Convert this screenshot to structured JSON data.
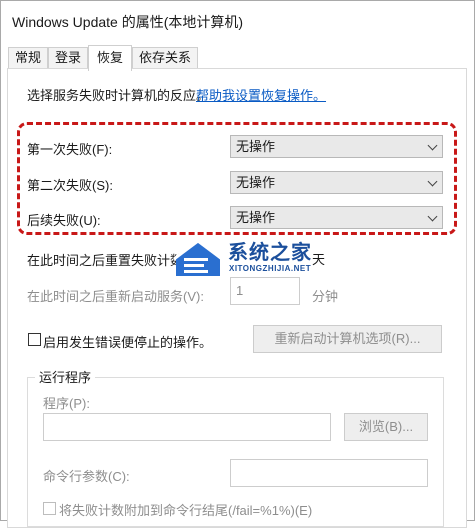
{
  "window": {
    "title": "Windows Update 的属性(本地计算机)"
  },
  "tabs": [
    {
      "label": "常规",
      "active": false
    },
    {
      "label": "登录",
      "active": false
    },
    {
      "label": "恢复",
      "active": true
    },
    {
      "label": "依存关系",
      "active": false
    }
  ],
  "recovery": {
    "intro": "选择服务失败时计算机的反应。",
    "help_link": "帮助我设置恢复操作。",
    "first_failure": {
      "label": "第一次失败(F):",
      "value": "无操作"
    },
    "second_failure": {
      "label": "第二次失败(S):",
      "value": "无操作"
    },
    "subsequent_failures": {
      "label": "后续失败(U):",
      "value": "无操作"
    },
    "reset_count": {
      "label": "在此时间之后重置失败计数",
      "unit": "天"
    },
    "restart_service": {
      "label": "在此时间之后重新启动服务(V):",
      "value": "1",
      "unit": "分钟"
    },
    "enable_actions": {
      "label": "启用发生错误便停止的操作。",
      "checked": false
    },
    "restart_computer_button": "重新启动计算机选项(R)..."
  },
  "run_program": {
    "title": "运行程序",
    "program_label": "程序(P):",
    "program_value": "",
    "browse_button": "浏览(B)...",
    "cmdline_label": "命令行参数(C):",
    "cmdline_value": "",
    "append_label": "将失败计数附加到命令行结尾(/fail=%1%)(E)",
    "append_checked": false
  },
  "watermark": {
    "text": "系统之家",
    "sub": "XITONGZHIJIA.NET"
  },
  "colors": {
    "dash_highlight": "#c81818",
    "link": "#0a5bc4",
    "watermark": "#1b4f9c"
  }
}
